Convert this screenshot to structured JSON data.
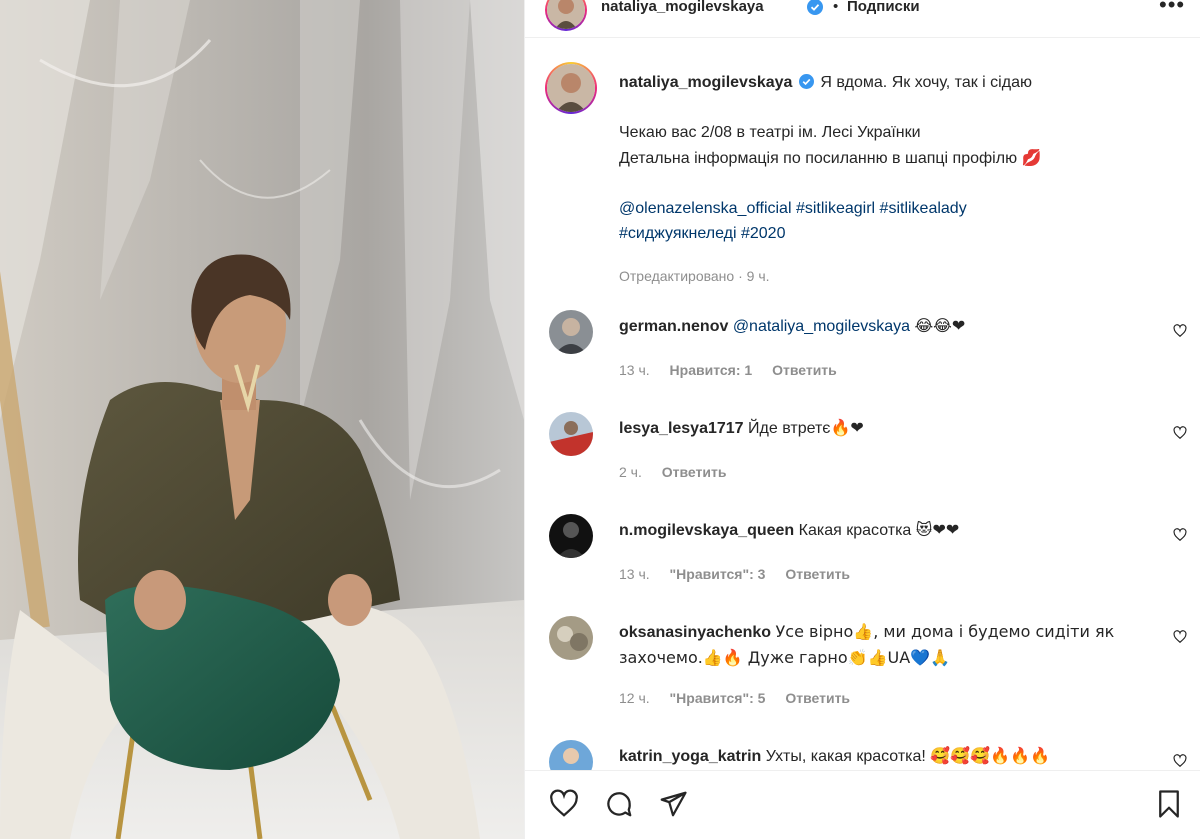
{
  "header": {
    "username": "nataliya_mogilevskaya",
    "dot": "•",
    "follow_label": "Подписки",
    "more": "•••"
  },
  "caption": {
    "username": "nataliya_mogilevskaya",
    "line1": "Я вдома. Як хочу, так і сідаю",
    "line2": "Чекаю вас 2/08 в театрі ім. Лесі Українки",
    "line3": "Детальна інформація по посиланню в шапці профілю",
    "line3_emoji": "💋",
    "mention": "@olenazelenska_official",
    "tag1": "#sitlikeagirl",
    "tag2": "#sitlikealady",
    "tag3": "#сиджуякнеледі",
    "tag4": "#2020",
    "edited": "Отредактировано",
    "sep": "·",
    "time": "9 ч."
  },
  "comments": [
    {
      "username": "german.nenov",
      "mention": "@nataliya_mogilevskaya",
      "text": "",
      "emoji": "😂😂❤",
      "time": "13 ч.",
      "likes": "Нравится: 1",
      "reply": "Ответить"
    },
    {
      "username": "lesya_lesya1717",
      "text": "Йде втретє",
      "emoji": "🔥❤",
      "time": "2 ч.",
      "reply": "Ответить"
    },
    {
      "username": "n.mogilevskaya_queen",
      "text": "Какая красотка",
      "emoji": "😻❤❤",
      "time": "13 ч.",
      "likes": "\"Нравится\": 3",
      "reply": "Ответить"
    },
    {
      "username": "oksanasinyachenko",
      "text": "Усе вірно👍, ми дома і будемо сидіти як",
      "text2": "захочемо.👍🔥 Дуже гарно👏👍UA💙🙏",
      "time": "12 ч.",
      "likes": "\"Нравится\": 5",
      "reply": "Ответить"
    },
    {
      "username": "katrin_yoga_katrin",
      "text": "Ухты, какая красотка!",
      "emoji": "🥰🥰🥰🔥🔥🔥"
    }
  ],
  "icons": {
    "like": "heart-icon",
    "comment": "comment-icon",
    "share": "paper-plane-icon",
    "save": "bookmark-icon",
    "verified": "verified-badge-icon",
    "comment_like": "heart-outline-icon"
  },
  "colors": {
    "link": "#00376b",
    "verified": "#3897f0",
    "meta": "#8e8e8e",
    "text": "#262626"
  }
}
